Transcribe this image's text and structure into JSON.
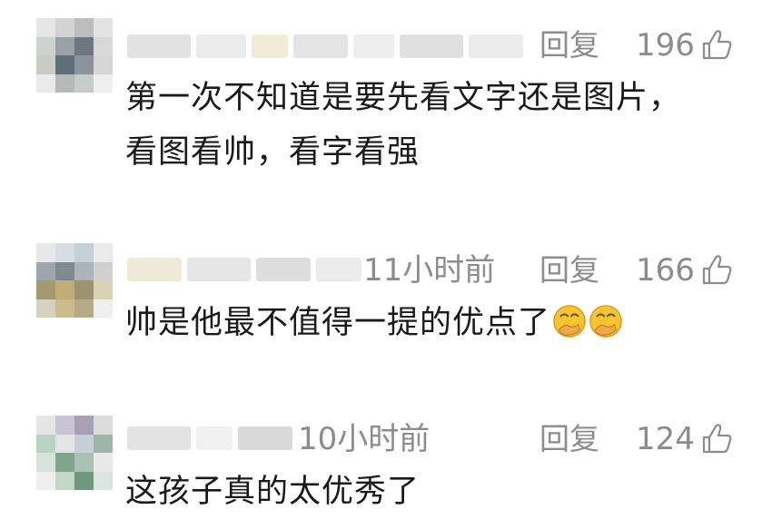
{
  "comments": [
    {
      "time": "",
      "reply_label": "回复",
      "likes": "196",
      "text_lines": [
        "第一次不知道是要先看文字还是图片，",
        "看图看帅，看字看强"
      ],
      "emoji_count": 0
    },
    {
      "time": "11小时前",
      "reply_label": "回复",
      "likes": "166",
      "text_lines": [
        "帅是他最不值得一提的优点了"
      ],
      "emoji_count": 2
    },
    {
      "time": "10小时前",
      "reply_label": "回复",
      "likes": "124",
      "text_lines": [
        "这孩子真的太优秀了"
      ],
      "emoji_count": 0
    }
  ],
  "icons": {
    "like": "thumbs-up-icon",
    "emoji": "hand-over-mouth-emoji"
  },
  "colors": {
    "meta": "#8c8c8c",
    "text": "#1a1a1a"
  }
}
